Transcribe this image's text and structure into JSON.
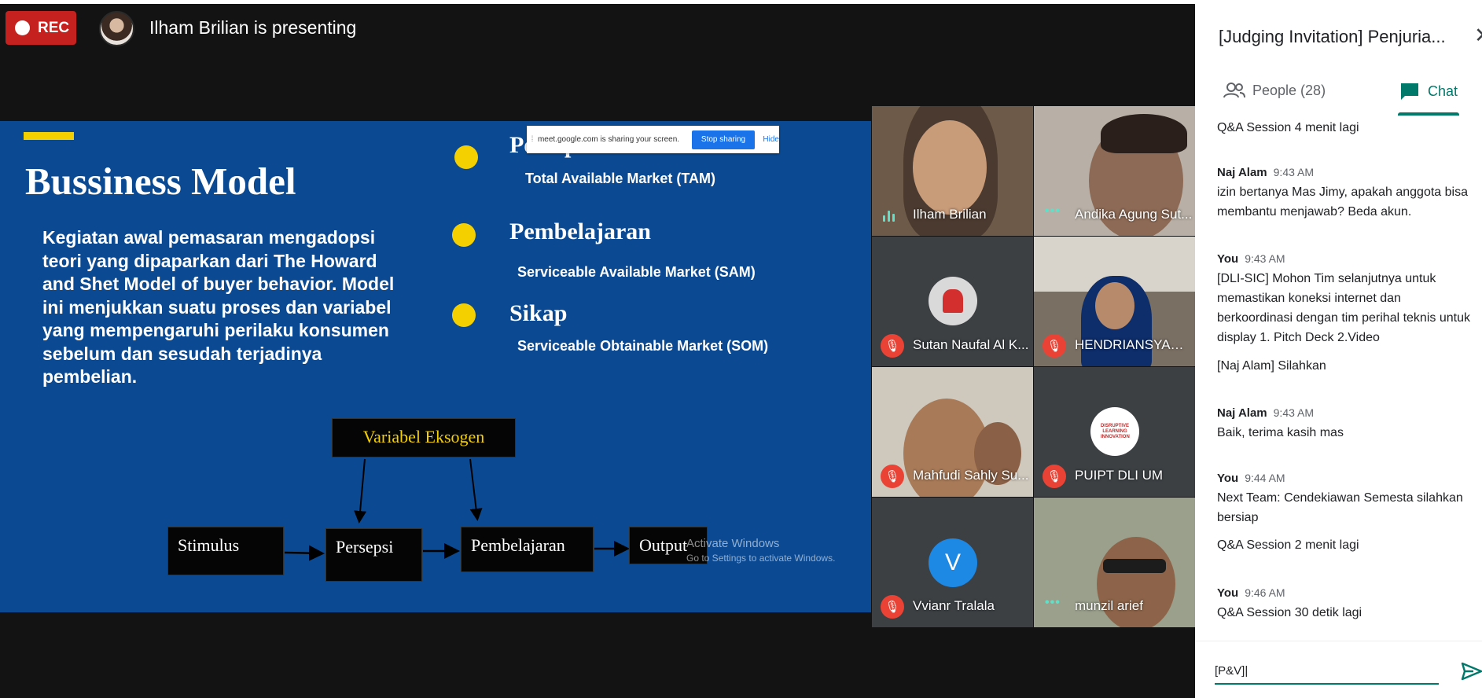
{
  "header": {
    "rec_label": "REC",
    "presenting_text": "Ilham Brilian is presenting"
  },
  "slide": {
    "title": "Bussiness Model",
    "body": "Kegiatan awal pemasaran mengadopsi teori yang dipaparkan dari The Howard and Shet Model of buyer behavior. Model ini menjukkan suatu proses dan variabel yang mempengaruhi perilaku konsumen sebelum dan sesudah terjadinya pembelian.",
    "bullets": [
      {
        "heading": "Persepsi",
        "sub": "Total Available Market (TAM)"
      },
      {
        "heading": "Pembelajaran",
        "sub": "Serviceable Available Market (SAM)"
      },
      {
        "heading": "Sikap",
        "sub": "Serviceable Obtainable Market (SOM)"
      }
    ],
    "diagram": {
      "eksogen": "Variabel Eksogen",
      "stimulus": "Stimulus",
      "persepsi": "Persepsi",
      "pembelajaran": "Pembelajaran",
      "output": "Output"
    },
    "watermark": {
      "title": "Activate Windows",
      "subtitle": "Go to Settings to activate Windows."
    }
  },
  "share_banner": {
    "text": "meet.google.com is sharing your screen.",
    "stop_label": "Stop sharing",
    "hide_label": "Hide"
  },
  "participants": [
    {
      "name": "Ilham Brilian",
      "status": "speaking"
    },
    {
      "name": "Andika Agung Sut...",
      "status": "active"
    },
    {
      "name": "Sutan Naufal Al K...",
      "status": "muted"
    },
    {
      "name": "HENDRIANSYAH ...",
      "status": "muted"
    },
    {
      "name": "Mahfudi Sahly Su...",
      "status": "muted"
    },
    {
      "name": "PUIPT DLI UM",
      "status": "muted"
    },
    {
      "name": "Vvianr Tralala",
      "status": "muted",
      "initial": "V"
    },
    {
      "name": "munzil arief",
      "status": "active"
    }
  ],
  "logo_text": "DISRUPTIVE LEARNING INNOVATION",
  "panel": {
    "title": "[Judging Invitation] Penjuria...",
    "people_label": "People (28)",
    "chat_label": "Chat",
    "messages": [
      {
        "text": "Q&A Session 4 menit lagi"
      },
      {
        "sender": "Naj Alam",
        "time": "9:43 AM",
        "text": "izin bertanya Mas Jimy, apakah anggota bisa membantu menjawab? Beda akun."
      },
      {
        "sender": "You",
        "time": "9:43 AM",
        "text": "[DLI-SIC] Mohon Tim selanjutnya untuk memastikan koneksi internet dan berkoordinasi dengan tim perihal teknis untuk display 1. Pitch Deck 2.Video"
      },
      {
        "text": "[Naj Alam] Silahkan"
      },
      {
        "sender": "Naj Alam",
        "time": "9:43 AM",
        "text": "Baik, terima kasih mas"
      },
      {
        "sender": "You",
        "time": "9:44 AM",
        "text": "Next Team: Cendekiawan Semesta silahkan bersiap"
      },
      {
        "text": "Q&A Session 2 menit lagi"
      },
      {
        "sender": "You",
        "time": "9:46 AM",
        "text": "Q&A Session 30 detik lagi"
      }
    ],
    "input_value": "[P&V]|"
  },
  "colors": {
    "rec": "#c5221f",
    "slide_bg": "#0b4a93",
    "accent_yellow": "#f5d000",
    "meet_teal": "#00796b",
    "muted_red": "#ea4335"
  }
}
